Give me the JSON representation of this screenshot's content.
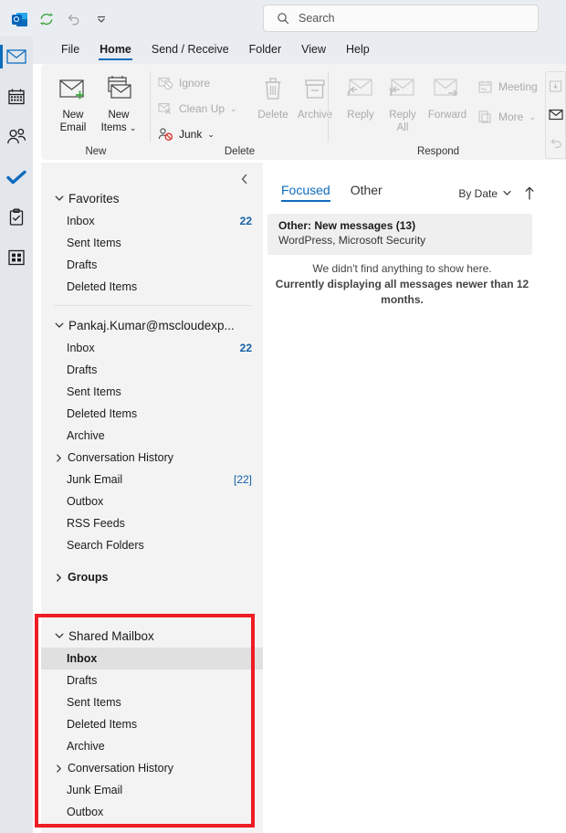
{
  "titlebar": {
    "logo_icon": "outlook-logo-icon",
    "sync_icon": "sync-icon",
    "undo_icon": "undo-icon",
    "more_icon": "chevron-down-icon"
  },
  "search": {
    "placeholder": "Search",
    "icon": "search-icon"
  },
  "tabs": [
    {
      "label": "File",
      "active": false
    },
    {
      "label": "Home",
      "active": true
    },
    {
      "label": "Send / Receive",
      "active": false
    },
    {
      "label": "Folder",
      "active": false
    },
    {
      "label": "View",
      "active": false
    },
    {
      "label": "Help",
      "active": false
    }
  ],
  "rail": [
    {
      "name": "mail-icon",
      "selected": true
    },
    {
      "name": "calendar-icon",
      "selected": false
    },
    {
      "name": "people-icon",
      "selected": false
    },
    {
      "name": "todo-check-icon",
      "selected": false
    },
    {
      "name": "tasks-clipboard-icon",
      "selected": false
    },
    {
      "name": "more-apps-icon",
      "selected": false
    }
  ],
  "ribbon": {
    "groups": [
      {
        "label": "New"
      },
      {
        "label": "Delete"
      },
      {
        "label": "Respond"
      }
    ],
    "new_email": {
      "line1": "New",
      "line2": "Email"
    },
    "new_items": {
      "line1": "New",
      "line2": "Items"
    },
    "ignore": "Ignore",
    "clean_up": "Clean Up",
    "junk": "Junk",
    "delete": "Delete",
    "archive": "Archive",
    "reply": "Reply",
    "reply_all_l1": "Reply",
    "reply_all_l2": "All",
    "forward": "Forward",
    "meeting": "Meeting",
    "more": "More"
  },
  "folderpane": {
    "collapse_icon": "chevron-left-icon",
    "sections": [
      {
        "title": "Favorites",
        "expanded": true,
        "items": [
          {
            "label": "Inbox",
            "count": "22",
            "chevron": false,
            "selected": false,
            "bracket": false
          },
          {
            "label": "Sent Items",
            "count": "",
            "chevron": false,
            "selected": false,
            "bracket": false
          },
          {
            "label": "Drafts",
            "count": "",
            "chevron": false,
            "selected": false,
            "bracket": false
          },
          {
            "label": "Deleted Items",
            "count": "",
            "chevron": false,
            "selected": false,
            "bracket": false
          }
        ]
      },
      {
        "title": "Pankaj.Kumar@mscloudexp...",
        "expanded": true,
        "items": [
          {
            "label": "Inbox",
            "count": "22",
            "chevron": false,
            "selected": false,
            "bracket": false
          },
          {
            "label": "Drafts",
            "count": "",
            "chevron": false,
            "selected": false,
            "bracket": false
          },
          {
            "label": "Sent Items",
            "count": "",
            "chevron": false,
            "selected": false,
            "bracket": false
          },
          {
            "label": "Deleted Items",
            "count": "",
            "chevron": false,
            "selected": false,
            "bracket": false
          },
          {
            "label": "Archive",
            "count": "",
            "chevron": false,
            "selected": false,
            "bracket": false
          },
          {
            "label": "Conversation History",
            "count": "",
            "chevron": true,
            "selected": false,
            "bracket": false
          },
          {
            "label": "Junk Email",
            "count": "[22]",
            "chevron": false,
            "selected": false,
            "bracket": true
          },
          {
            "label": "Outbox",
            "count": "",
            "chevron": false,
            "selected": false,
            "bracket": false
          },
          {
            "label": "RSS Feeds",
            "count": "",
            "chevron": false,
            "selected": false,
            "bracket": false
          },
          {
            "label": "Search Folders",
            "count": "",
            "chevron": false,
            "selected": false,
            "bracket": false
          }
        ]
      },
      {
        "title": "Groups",
        "expanded": false,
        "collapsed_head": true,
        "items": []
      },
      {
        "title": "Shared Mailbox",
        "expanded": true,
        "items": [
          {
            "label": "Inbox",
            "count": "",
            "chevron": false,
            "selected": true,
            "bracket": false
          },
          {
            "label": "Drafts",
            "count": "",
            "chevron": false,
            "selected": false,
            "bracket": false
          },
          {
            "label": "Sent Items",
            "count": "",
            "chevron": false,
            "selected": false,
            "bracket": false
          },
          {
            "label": "Deleted Items",
            "count": "",
            "chevron": false,
            "selected": false,
            "bracket": false
          },
          {
            "label": "Archive",
            "count": "",
            "chevron": false,
            "selected": false,
            "bracket": false
          },
          {
            "label": "Conversation History",
            "count": "",
            "chevron": true,
            "selected": false,
            "bracket": false
          },
          {
            "label": "Junk Email",
            "count": "",
            "chevron": false,
            "selected": false,
            "bracket": false
          },
          {
            "label": "Outbox",
            "count": "",
            "chevron": false,
            "selected": false,
            "bracket": false
          }
        ]
      }
    ]
  },
  "messagepane": {
    "tab_focused": "Focused",
    "tab_other": "Other",
    "sort_label": "By Date",
    "sort_chevron_icon": "chevron-down-icon",
    "sort_direction_icon": "arrow-up-icon",
    "other_banner_title": "Other: New messages (13)",
    "other_banner_subtitle": "WordPress, Microsoft Security",
    "empty_line1": "We didn't find anything to show here.",
    "empty_line2": "Currently displaying all messages newer than 12 months."
  },
  "annotation": {
    "color": "#EE1C25"
  }
}
